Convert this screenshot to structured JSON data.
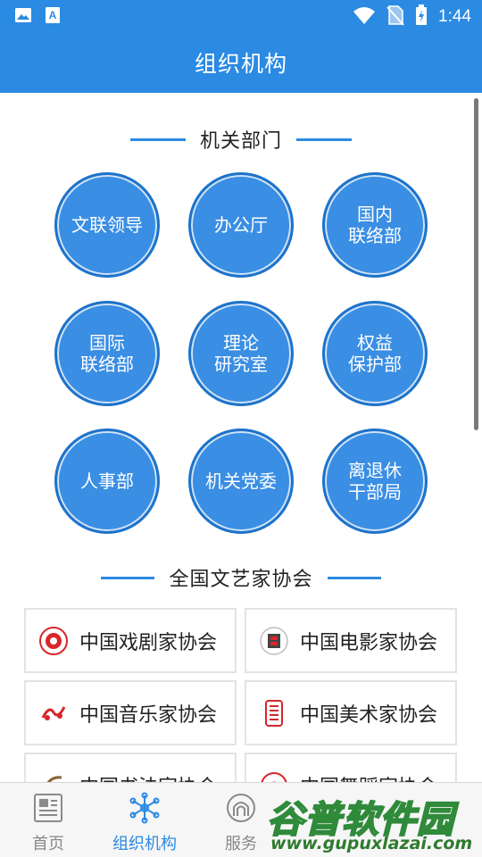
{
  "status_bar": {
    "time": "1:44",
    "icons": [
      "image-icon",
      "text-notification-icon",
      "wifi-icon",
      "no-sim-icon",
      "battery-charging-icon"
    ]
  },
  "app_bar": {
    "title": "组织机构"
  },
  "sections": {
    "departments": {
      "heading": "机关部门",
      "items": [
        {
          "label": "文联领导"
        },
        {
          "label": "办公厅"
        },
        {
          "label": "国内\n联络部"
        },
        {
          "label": "国际\n联络部"
        },
        {
          "label": "理论\n研究室"
        },
        {
          "label": "权益\n保护部"
        },
        {
          "label": "人事部"
        },
        {
          "label": "机关党委"
        },
        {
          "label": "离退休\n干部局"
        }
      ]
    },
    "associations": {
      "heading": "全国文艺家协会",
      "items": [
        {
          "label": "中国戏剧家协会",
          "logo": "drama-association-logo"
        },
        {
          "label": "中国电影家协会",
          "logo": "film-association-logo"
        },
        {
          "label": "中国音乐家协会",
          "logo": "music-association-logo"
        },
        {
          "label": "中国美术家协会",
          "logo": "art-association-logo"
        },
        {
          "label": "中国书法家协会",
          "logo": "calligraphy-association-logo"
        },
        {
          "label": "中国舞蹈家协会",
          "logo": "dance-association-logo"
        }
      ]
    }
  },
  "bottom_nav": {
    "items": [
      {
        "label": "首页",
        "icon": "newspaper-icon",
        "active": false
      },
      {
        "label": "组织机构",
        "icon": "network-icon",
        "active": true
      },
      {
        "label": "服务",
        "icon": "service-icon",
        "active": false
      }
    ]
  },
  "watermark": {
    "text": "谷普软件园",
    "url": "www.gupuxlazai.com"
  },
  "colors": {
    "primary": "#2b8ae2",
    "circle_fill": "#3a8ee3",
    "circle_border": "#1e73c9",
    "card_border": "#e3e3e3",
    "nav_inactive": "#888888"
  }
}
